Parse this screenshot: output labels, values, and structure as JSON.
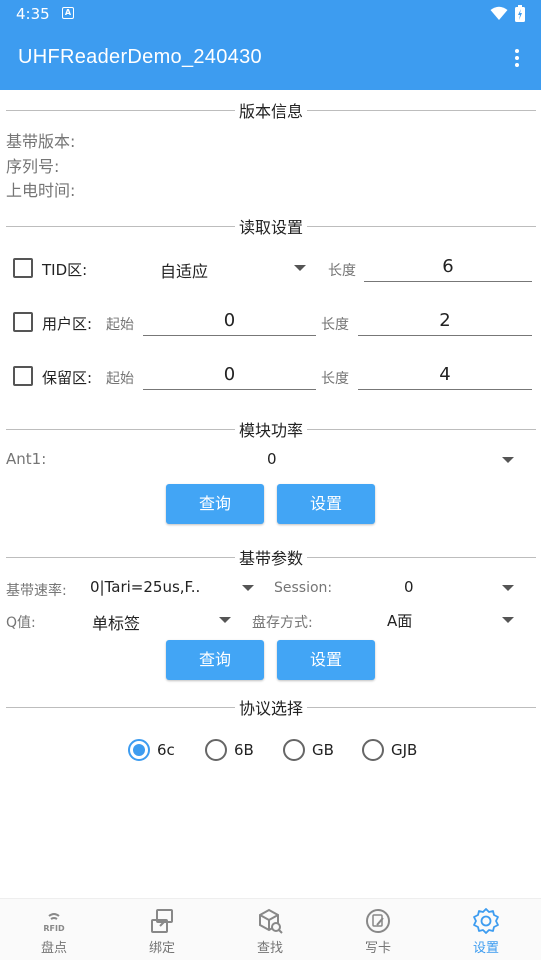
{
  "status": {
    "time": "4:35",
    "notif": "A"
  },
  "app": {
    "title": "UHFReaderDemo_240430"
  },
  "version": {
    "header": "版本信息",
    "baseband_label": "基带版本:",
    "serial_label": "序列号:",
    "poweron_label": "上电时间:"
  },
  "read": {
    "header": "读取设置",
    "tid_label": "TID区:",
    "tid_mode": "自适应",
    "length_label": "长度",
    "tid_length": "6",
    "user_label": "用户区:",
    "start_label": "起始",
    "user_start": "0",
    "user_length": "2",
    "reserve_label": "保留区:",
    "reserve_start": "0",
    "reserve_length": "4"
  },
  "power": {
    "header": "模块功率",
    "ant_label": "Ant1:",
    "ant_value": "0",
    "query_label": "查询",
    "set_label": "设置"
  },
  "baseband": {
    "header": "基带参数",
    "rate_label": "基带速率:",
    "rate_value": "0|Tari=25us,F..",
    "session_label": "Session:",
    "session_value": "0",
    "q_label": "Q值:",
    "q_value": "单标签",
    "inventory_label": "盘存方式:",
    "inventory_value": "A面",
    "query_label": "查询",
    "set_label": "设置"
  },
  "protocol": {
    "header": "协议选择",
    "options": [
      "6c",
      "6B",
      "GB",
      "GJB"
    ],
    "selected": "6c"
  },
  "nav": {
    "items": [
      {
        "label": "盘点",
        "icon": "rfid-icon"
      },
      {
        "label": "绑定",
        "icon": "bind-icon"
      },
      {
        "label": "查找",
        "icon": "find-icon"
      },
      {
        "label": "写卡",
        "icon": "write-icon"
      },
      {
        "label": "设置",
        "icon": "settings-gear-icon"
      }
    ],
    "active": "设置",
    "rfid_text": "RFID"
  },
  "colors": {
    "primary": "#3d9cf0",
    "button": "#42a5f5"
  }
}
